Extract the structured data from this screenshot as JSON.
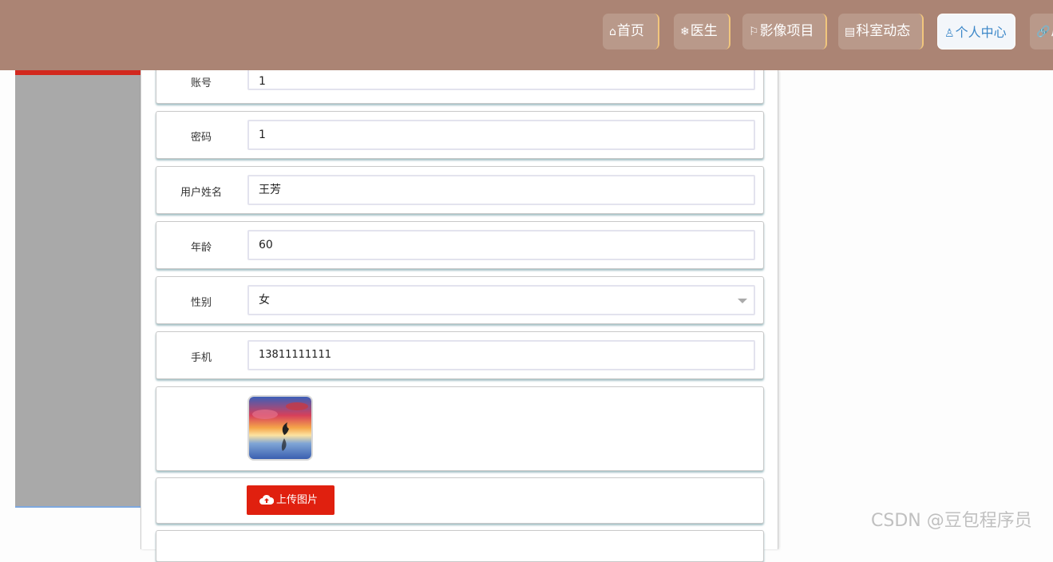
{
  "nav": {
    "items": [
      {
        "icon": "home-icon",
        "label": "首页"
      },
      {
        "icon": "snowflake-icon",
        "label": "医生"
      },
      {
        "icon": "flag-icon",
        "label": "影像项目"
      },
      {
        "icon": "clipboard-icon",
        "label": "科室动态"
      },
      {
        "icon": "user-icon",
        "label": "个人中心",
        "active": true
      },
      {
        "icon": "link-icon",
        "label": "后"
      }
    ]
  },
  "form": {
    "account": {
      "label": "账号",
      "value": "1"
    },
    "password": {
      "label": "密码",
      "value": "1"
    },
    "username": {
      "label": "用户姓名",
      "value": "王芳"
    },
    "age": {
      "label": "年龄",
      "value": "60"
    },
    "gender": {
      "label": "性别",
      "value": "女"
    },
    "phone": {
      "label": "手机",
      "value": "13811111111"
    },
    "upload_label": "上传图片"
  },
  "watermark": "CSDN @豆包程序员",
  "colors": {
    "topbar": "#ab8474",
    "accent": "#e0200f",
    "active_text": "#3c87c8"
  }
}
